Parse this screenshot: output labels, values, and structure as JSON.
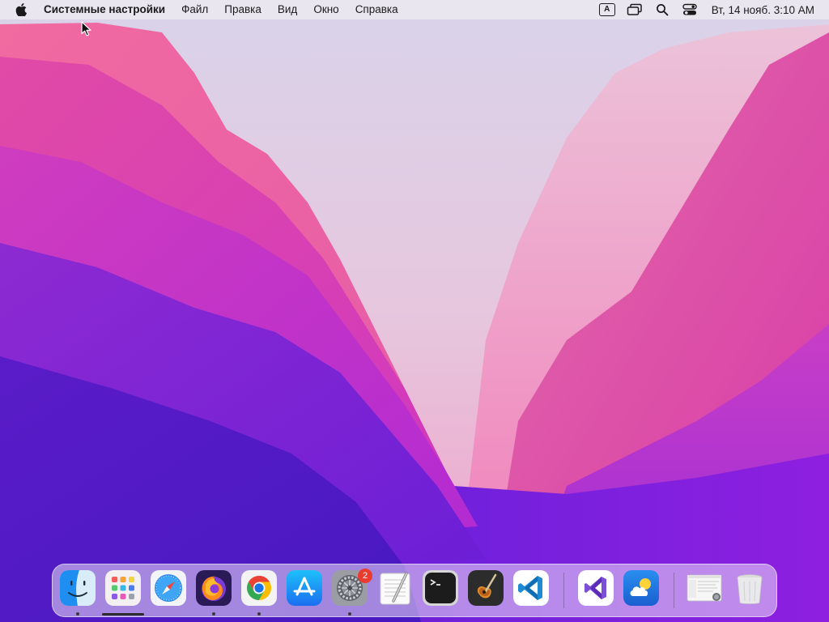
{
  "menubar": {
    "app_name": "Системные настройки",
    "menus": [
      "Файл",
      "Правка",
      "Вид",
      "Окно",
      "Справка"
    ],
    "input_source": "A",
    "clock": "Вт, 14 нояб.  3:10 AM"
  },
  "dock": {
    "apps": [
      {
        "icon": "finder-icon",
        "running": true
      },
      {
        "icon": "launchpad-icon",
        "running": false
      },
      {
        "icon": "safari-icon",
        "running": false
      },
      {
        "icon": "firefox-icon",
        "running": true
      },
      {
        "icon": "chrome-icon",
        "running": true
      },
      {
        "icon": "app-store-icon",
        "running": false
      },
      {
        "icon": "system-settings-icon",
        "running": true,
        "badge": "2"
      },
      {
        "icon": "textedit-icon",
        "running": false
      },
      {
        "icon": "terminal-icon",
        "running": false
      },
      {
        "icon": "garageband-icon",
        "running": false
      },
      {
        "icon": "vscode-icon",
        "running": false
      },
      {
        "icon": "visual-studio-icon",
        "running": false
      },
      {
        "icon": "weather-icon",
        "running": false
      },
      {
        "icon": "screenshot-thumbnail-icon",
        "running": false
      },
      {
        "icon": "trash-icon",
        "running": false
      }
    ],
    "badge_count": "2"
  },
  "colors": {
    "menubar_bg": "#ECE8F0",
    "wallpaper_magenta": "#C92FC4",
    "wallpaper_purple": "#6A1FD8",
    "badge_red": "#EA3B2F"
  }
}
